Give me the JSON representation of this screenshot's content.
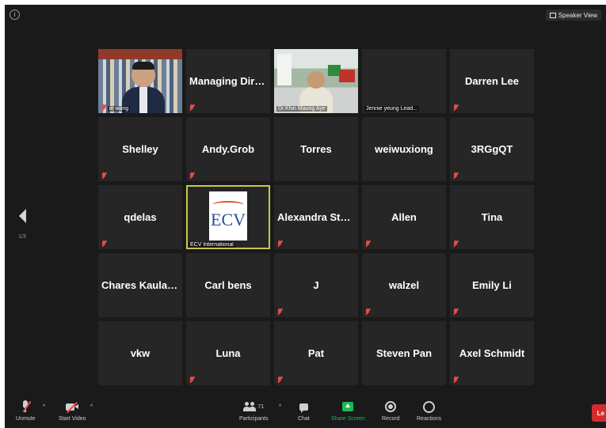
{
  "header": {
    "info_icon": "info-icon",
    "view_toggle_label": "Speaker View"
  },
  "pager": {
    "page_label": "1/3"
  },
  "tiles": [
    {
      "type": "video",
      "scene": "office",
      "caption": "ie wang",
      "muted": true
    },
    {
      "type": "name",
      "name": "Managing Direc...",
      "muted": true
    },
    {
      "type": "video",
      "scene": "room",
      "caption": "Dr.Khin Maung Aye",
      "muted": false
    },
    {
      "type": "caption-only",
      "caption": "Jennie yeung Lead...",
      "muted": false
    },
    {
      "type": "name",
      "name": "Darren Lee",
      "muted": true
    },
    {
      "type": "name",
      "name": "Shelley",
      "muted": true
    },
    {
      "type": "name",
      "name": "Andy.Grob",
      "muted": true
    },
    {
      "type": "name",
      "name": "Torres",
      "muted": false
    },
    {
      "type": "name",
      "name": "weiwuxiong",
      "muted": false
    },
    {
      "type": "name",
      "name": "3RGgQT",
      "muted": true
    },
    {
      "type": "name",
      "name": "qdelas",
      "muted": true
    },
    {
      "type": "logo",
      "logo_text": "ECV",
      "caption": "ECV International",
      "muted": false,
      "active": true
    },
    {
      "type": "name",
      "name": "Alexandra  Stath...",
      "muted": true
    },
    {
      "type": "name",
      "name": "Allen",
      "muted": true
    },
    {
      "type": "name",
      "name": "Tina",
      "muted": true
    },
    {
      "type": "name",
      "name": "Chares Kauland",
      "muted": false
    },
    {
      "type": "name",
      "name": "Carl bens",
      "muted": false
    },
    {
      "type": "name",
      "name": "J",
      "muted": true
    },
    {
      "type": "name",
      "name": "walzel",
      "muted": true
    },
    {
      "type": "name",
      "name": "Emily Li",
      "muted": true
    },
    {
      "type": "name",
      "name": "vkw",
      "muted": false
    },
    {
      "type": "name",
      "name": "Luna",
      "muted": true
    },
    {
      "type": "name",
      "name": "Pat",
      "muted": true
    },
    {
      "type": "name",
      "name": "Steven Pan",
      "muted": false
    },
    {
      "type": "name",
      "name": "Axel Schmidt",
      "muted": true
    }
  ],
  "toolbar": {
    "unmute": "Unmute",
    "start_video": "Start Video",
    "participants": "Participants",
    "participant_count": "71",
    "chat": "Chat",
    "share_screen": "Share Screen",
    "record": "Record",
    "reactions": "Reactions",
    "leave": "Le"
  },
  "colors": {
    "background": "#1a1a1a",
    "tile": "#262626",
    "active_border": "#c9c84a",
    "muted_red": "#e94b4b",
    "share_green": "#1db954",
    "leave_red": "#d22d2d"
  }
}
